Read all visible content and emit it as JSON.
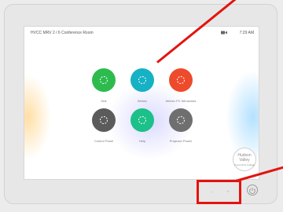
{
  "device": {
    "room_title": "HVCC MRV 2 / 6 Conference Room",
    "clock": "7:29 AM",
    "camera_icon": "camera-icon"
  },
  "tiles": [
    {
      "label": "Dial",
      "color": "#2dbb4e",
      "icon": "dial-icon"
    },
    {
      "label": "Webex",
      "color": "#16b1c4",
      "icon": "webex-icon"
    },
    {
      "label": "Webex PC Windowed",
      "color": "#ee4a2c",
      "icon": "share-icon"
    },
    {
      "label": "Control Panel",
      "color": "#5b5b5b",
      "icon": "control-icon"
    },
    {
      "label": "Help",
      "color": "#1cc089",
      "icon": "help-icon"
    },
    {
      "label": "Projector Power",
      "color": "#6f6f6f",
      "icon": "power-icon"
    }
  ],
  "logo": {
    "line1": "Hudson",
    "line2": "Valley",
    "line3": "Community College"
  },
  "hardware": {
    "volume_down": "–",
    "volume_up": "+",
    "power_icon": "power-icon"
  },
  "colors": {
    "highlight": "#e3140f",
    "accent": "#16b1c4"
  }
}
